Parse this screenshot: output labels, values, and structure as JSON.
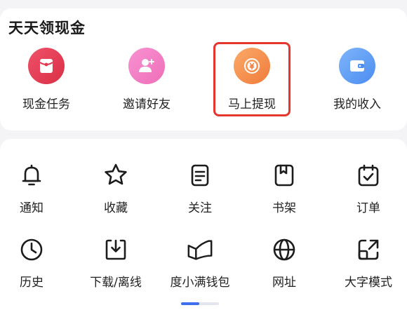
{
  "cash_section": {
    "title": "天天领现金",
    "items": [
      {
        "label": "现金任务",
        "icon": "red-envelope-icon",
        "color_start": "#f0516a",
        "color_end": "#d92f46"
      },
      {
        "label": "邀请好友",
        "icon": "add-user-icon",
        "color_start": "#f892d2",
        "color_end": "#ee6eb8"
      },
      {
        "label": "马上提现",
        "icon": "yuan-coin-icon",
        "color_start": "#fbaa6a",
        "color_end": "#f07b3a"
      },
      {
        "label": "我的收入",
        "icon": "wallet-icon",
        "color_start": "#7fb5fb",
        "color_end": "#4a8cf0"
      }
    ],
    "highlight_color": "#e5372d"
  },
  "tools": {
    "items": [
      {
        "label": "通知",
        "icon": "bell-icon"
      },
      {
        "label": "收藏",
        "icon": "star-icon"
      },
      {
        "label": "关注",
        "icon": "document-icon"
      },
      {
        "label": "书架",
        "icon": "bookmark-book-icon"
      },
      {
        "label": "订单",
        "icon": "calendar-check-icon"
      },
      {
        "label": "历史",
        "icon": "clock-icon"
      },
      {
        "label": "下载/离线",
        "icon": "download-icon"
      },
      {
        "label": "度小满钱包",
        "icon": "wallet-logo-icon"
      },
      {
        "label": "网址",
        "icon": "globe-icon"
      },
      {
        "label": "大字模式",
        "icon": "resize-icon"
      }
    ]
  },
  "pager": {
    "active_color": "#3d6ff0",
    "inactive_color": "#e3e6ee"
  }
}
